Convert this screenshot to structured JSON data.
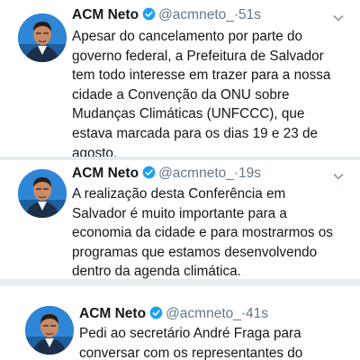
{
  "colors": {
    "background": "#e6ecf0",
    "card": "#ffffff",
    "text": "#14171a",
    "secondary_text": "#657786",
    "verified_blue": "#1da1f2"
  },
  "icons": [
    "avatar-icon",
    "verified-badge-icon",
    "chevron-down-icon"
  ],
  "tweets": [
    {
      "author_name": "ACM Neto",
      "handle": "@acmneto_",
      "separator": "·",
      "time": "51s",
      "lines": [
        "Apesar do cancelamento por parte do",
        "governo federal, a Prefeitura de Salvador",
        "tem todo interesse em trazer para a nossa",
        "cidade a Convenção da ONU sobre",
        "Mudanças Climáticas (UNFCCC), que",
        "estava marcada para os dias 19 e 23 de",
        "agosto."
      ]
    },
    {
      "author_name": "ACM Neto",
      "handle": "@acmneto_",
      "separator": "·",
      "time": "19s",
      "lines": [
        "A realização desta Conferência em",
        "Salvador é muito importante para a",
        "economia da cidade e para mostrarmos os",
        "programas que estamos desenvolvendo",
        "dentro da agenda climática."
      ]
    },
    {
      "author_name": "ACM Neto",
      "handle": "@acmneto_",
      "separator": "·",
      "time": "41s",
      "lines": [
        "Pedi ao secretário André Fraga para",
        "conversar com os representantes do"
      ]
    }
  ]
}
